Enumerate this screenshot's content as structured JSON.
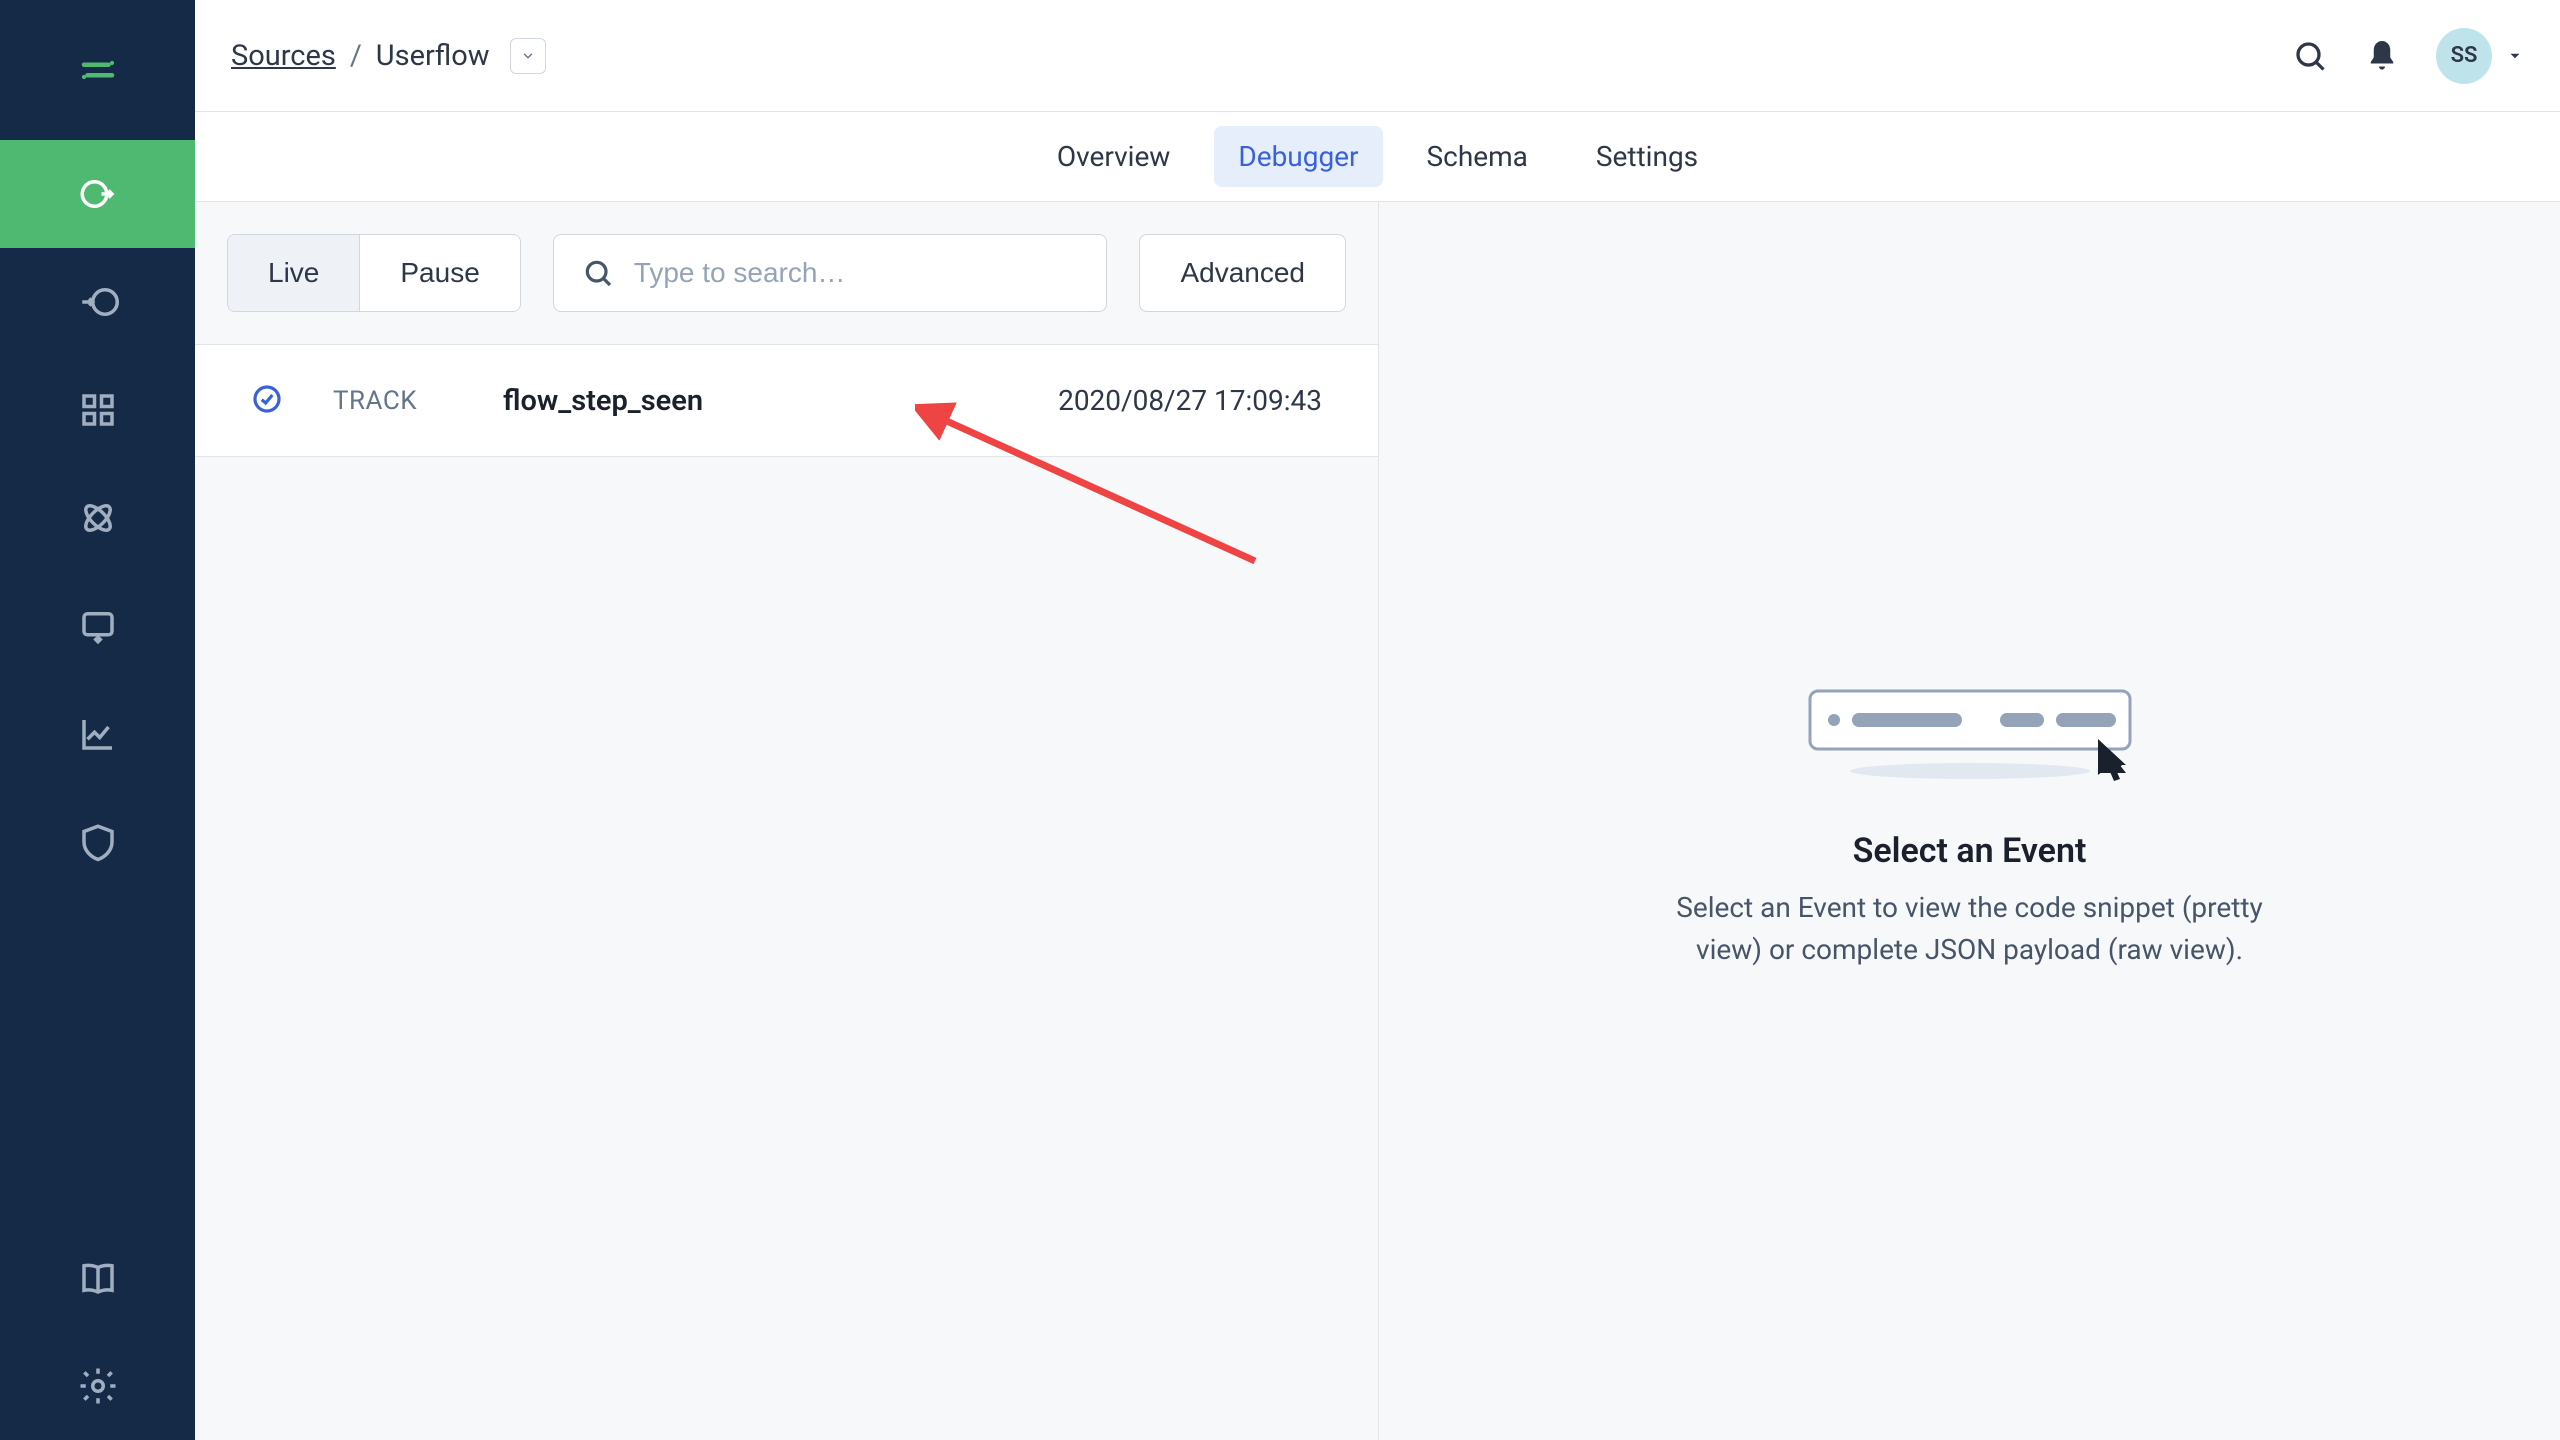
{
  "breadcrumb": {
    "root": "Sources",
    "current": "Userflow"
  },
  "user": {
    "initials": "SS"
  },
  "tabs": [
    {
      "label": "Overview",
      "active": false
    },
    {
      "label": "Debugger",
      "active": true
    },
    {
      "label": "Schema",
      "active": false
    },
    {
      "label": "Settings",
      "active": false
    }
  ],
  "controls": {
    "live_label": "Live",
    "pause_label": "Pause",
    "search_placeholder": "Type to search…",
    "advanced_label": "Advanced"
  },
  "events": [
    {
      "type_label": "TRACK",
      "name": "flow_step_seen",
      "timestamp": "2020/08/27 17:09:43"
    }
  ],
  "detail_empty": {
    "title": "Select an Event",
    "description": "Select an Event to view the code snippet (pretty view) or complete JSON payload (raw view)."
  }
}
